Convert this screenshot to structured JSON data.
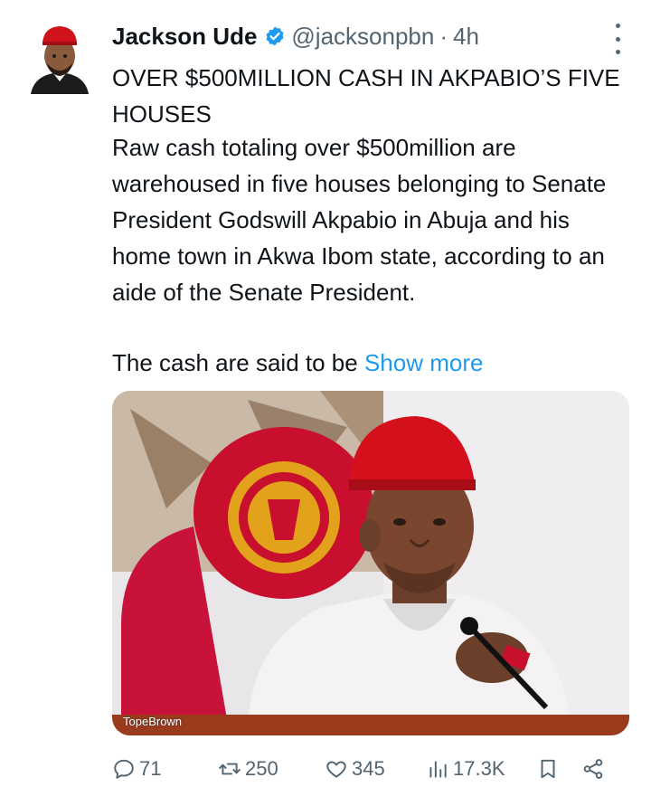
{
  "tweet": {
    "author_name": "Jackson Ude",
    "handle": "@jacksonpbn",
    "separator": "·",
    "time": "4h",
    "headline": "OVER $500MILLION CASH IN AKPABIO’S FIVE  HOUSES",
    "body": "Raw cash totaling over $500million are warehoused in five houses belonging to Senate President Godswill Akpabio in Abuja and his home town in Akwa Ibom state, according to an aide of the Senate President.",
    "teaser": "The cash are said to be ",
    "show_more": "Show more",
    "image_credit": "TopeBrown"
  },
  "actions": {
    "replies": "71",
    "retweets": "250",
    "likes": "345",
    "views": "17.3K"
  },
  "colors": {
    "text": "#0f1419",
    "muted": "#536471",
    "link": "#1d9bf0",
    "verified": "#1d9bf0"
  },
  "icons": [
    "avatar",
    "verified-badge-icon",
    "more-options-icon",
    "reply-icon",
    "retweet-icon",
    "like-icon",
    "views-icon",
    "bookmark-icon",
    "share-icon"
  ]
}
